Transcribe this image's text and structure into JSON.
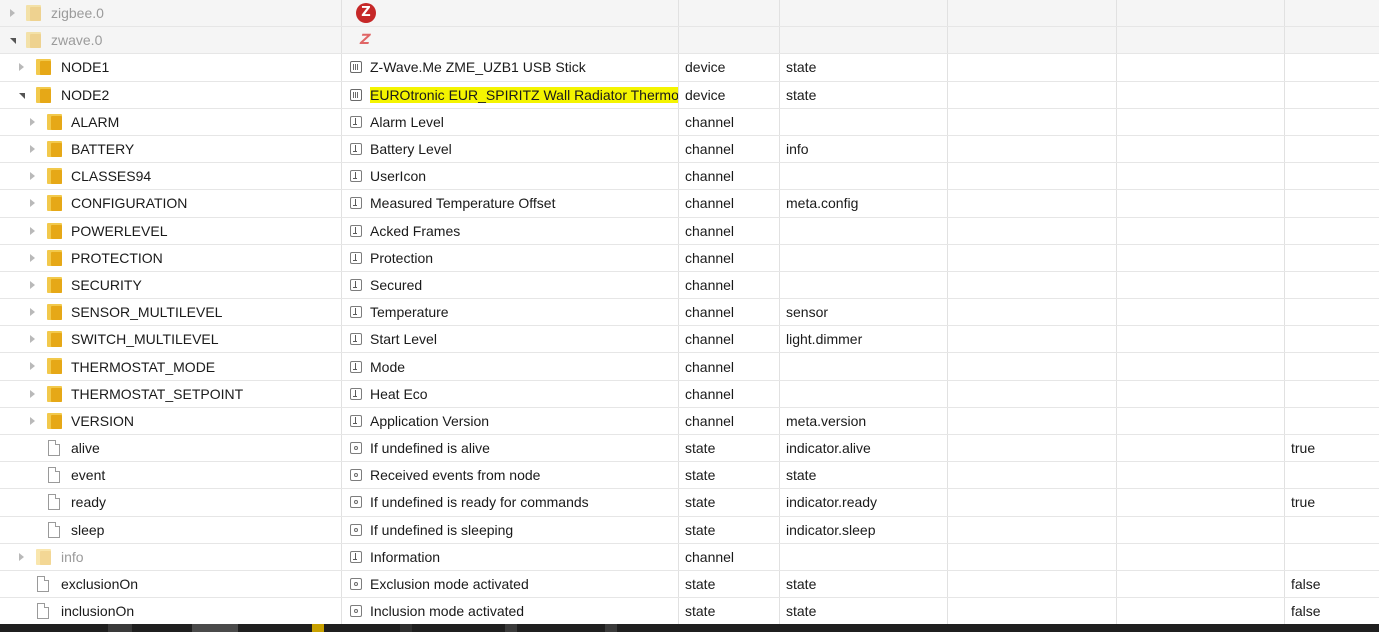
{
  "rows": [
    {
      "id": "zigbee.0",
      "name": "",
      "type": "",
      "role": "",
      "value": "",
      "level": 0,
      "expand": "collapsed",
      "icon": "folder",
      "dim": true,
      "nameIcon": "zigbee-logo",
      "grey": true
    },
    {
      "id": "zwave.0",
      "name": "",
      "type": "",
      "role": "",
      "value": "",
      "level": 0,
      "expand": "expanded",
      "icon": "folder",
      "dim": true,
      "nameIcon": "zwave-logo",
      "grey": true
    },
    {
      "id": "NODE1",
      "name": "Z-Wave.Me ZME_UZB1 USB Stick",
      "type": "device",
      "role": "state",
      "value": "",
      "level": 1,
      "expand": "collapsed",
      "icon": "folder",
      "nameIcon": "device"
    },
    {
      "id": "NODE2",
      "name": "EUROtronic EUR_SPIRITZ Wall Radiator Thermos...",
      "type": "device",
      "role": "state",
      "value": "",
      "level": 1,
      "expand": "expanded",
      "icon": "folder",
      "nameIcon": "device",
      "highlight": true
    },
    {
      "id": "ALARM",
      "name": "Alarm Level",
      "type": "channel",
      "role": "",
      "value": "",
      "level": 2,
      "expand": "collapsed",
      "icon": "folder",
      "nameIcon": "channel"
    },
    {
      "id": "BATTERY",
      "name": "Battery Level",
      "type": "channel",
      "role": "info",
      "value": "",
      "level": 2,
      "expand": "collapsed",
      "icon": "folder",
      "nameIcon": "channel"
    },
    {
      "id": "CLASSES94",
      "name": "UserIcon",
      "type": "channel",
      "role": "",
      "value": "",
      "level": 2,
      "expand": "collapsed",
      "icon": "folder",
      "nameIcon": "channel"
    },
    {
      "id": "CONFIGURATION",
      "name": "Measured Temperature Offset",
      "type": "channel",
      "role": "meta.config",
      "value": "",
      "level": 2,
      "expand": "collapsed",
      "icon": "folder",
      "nameIcon": "channel"
    },
    {
      "id": "POWERLEVEL",
      "name": "Acked Frames",
      "type": "channel",
      "role": "",
      "value": "",
      "level": 2,
      "expand": "collapsed",
      "icon": "folder",
      "nameIcon": "channel"
    },
    {
      "id": "PROTECTION",
      "name": "Protection",
      "type": "channel",
      "role": "",
      "value": "",
      "level": 2,
      "expand": "collapsed",
      "icon": "folder",
      "nameIcon": "channel"
    },
    {
      "id": "SECURITY",
      "name": "Secured",
      "type": "channel",
      "role": "",
      "value": "",
      "level": 2,
      "expand": "collapsed",
      "icon": "folder",
      "nameIcon": "channel"
    },
    {
      "id": "SENSOR_MULTILEVEL",
      "name": "Temperature",
      "type": "channel",
      "role": "sensor",
      "value": "",
      "level": 2,
      "expand": "collapsed",
      "icon": "folder",
      "nameIcon": "channel"
    },
    {
      "id": "SWITCH_MULTILEVEL",
      "name": "Start Level",
      "type": "channel",
      "role": "light.dimmer",
      "value": "",
      "level": 2,
      "expand": "collapsed",
      "icon": "folder",
      "nameIcon": "channel"
    },
    {
      "id": "THERMOSTAT_MODE",
      "name": "Mode",
      "type": "channel",
      "role": "",
      "value": "",
      "level": 2,
      "expand": "collapsed",
      "icon": "folder",
      "nameIcon": "channel"
    },
    {
      "id": "THERMOSTAT_SETPOINT",
      "name": "Heat Eco",
      "type": "channel",
      "role": "",
      "value": "",
      "level": 2,
      "expand": "collapsed",
      "icon": "folder",
      "nameIcon": "channel"
    },
    {
      "id": "VERSION",
      "name": "Application Version",
      "type": "channel",
      "role": "meta.version",
      "value": "",
      "level": 2,
      "expand": "collapsed",
      "icon": "folder",
      "nameIcon": "channel"
    },
    {
      "id": "alive",
      "name": "If undefined is alive",
      "type": "state",
      "role": "indicator.alive",
      "value": "true",
      "level": 2,
      "expand": "none",
      "icon": "file",
      "nameIcon": "state"
    },
    {
      "id": "event",
      "name": "Received events from node",
      "type": "state",
      "role": "state",
      "value": "",
      "level": 2,
      "expand": "none",
      "icon": "file",
      "nameIcon": "state"
    },
    {
      "id": "ready",
      "name": "If undefined is ready for commands",
      "type": "state",
      "role": "indicator.ready",
      "value": "true",
      "level": 2,
      "expand": "none",
      "icon": "file",
      "nameIcon": "state"
    },
    {
      "id": "sleep",
      "name": "If undefined is sleeping",
      "type": "state",
      "role": "indicator.sleep",
      "value": "",
      "level": 2,
      "expand": "none",
      "icon": "file",
      "nameIcon": "state"
    },
    {
      "id": "info",
      "name": "Information",
      "type": "channel",
      "role": "",
      "value": "",
      "level": 1,
      "expand": "collapsed",
      "icon": "folder",
      "dim": true,
      "nameIcon": "channel"
    },
    {
      "id": "exclusionOn",
      "name": "Exclusion mode activated",
      "type": "state",
      "role": "state",
      "value": "false",
      "level": 1,
      "expand": "none",
      "icon": "file",
      "nameIcon": "state"
    },
    {
      "id": "inclusionOn",
      "name": "Inclusion mode activated",
      "type": "state",
      "role": "state",
      "value": "false",
      "level": 1,
      "expand": "none",
      "icon": "file",
      "nameIcon": "state"
    }
  ],
  "logos": {
    "zigbee": "Z",
    "zwave": "Z"
  },
  "colors": {
    "highlight": "#f4f400",
    "folder": "#f2c94c",
    "zigbee": "#c62828"
  }
}
